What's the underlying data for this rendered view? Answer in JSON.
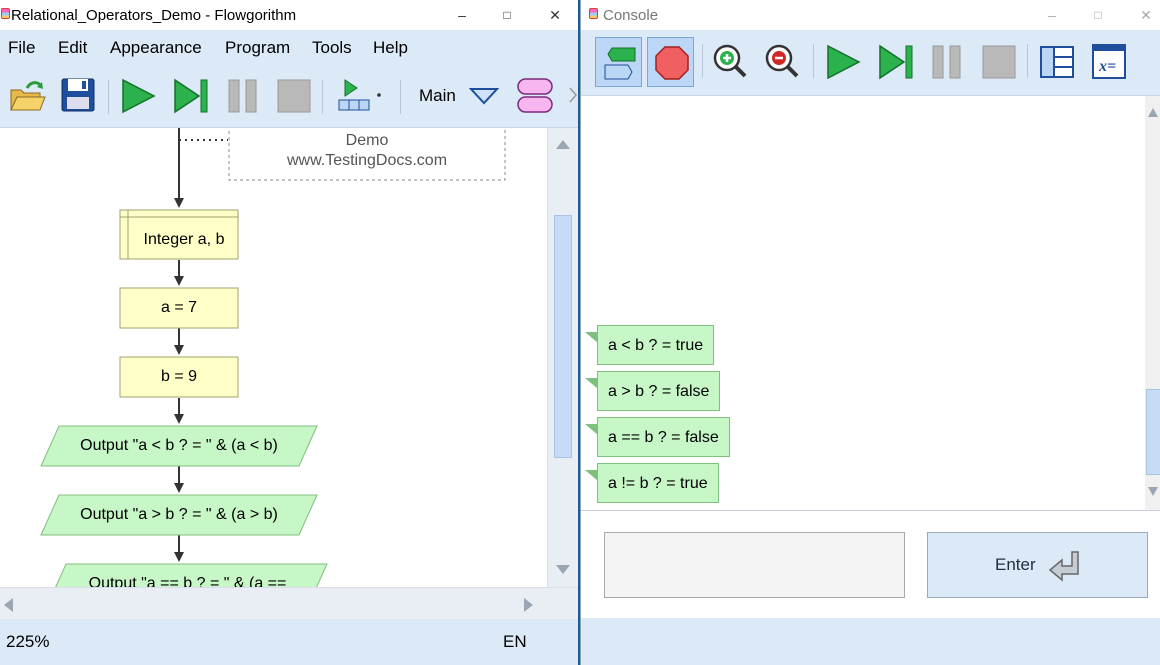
{
  "left_window": {
    "title": "Relational_Operators_Demo - Flowgorithm",
    "controls": {
      "minimize": "–",
      "maximize": "□",
      "close": "✕"
    },
    "menu": [
      "File",
      "Edit",
      "Appearance",
      "Program",
      "Tools",
      "Help"
    ],
    "toolbar": {
      "icons": [
        "open-icon",
        "save-icon",
        "run-icon",
        "step-icon",
        "pause-icon",
        "stop-icon",
        "layout-icon",
        "function-shape-icon"
      ],
      "function_select": "Main"
    },
    "flowchart": {
      "comment_lines": [
        "Demo",
        "www.TestingDocs.com"
      ],
      "declare": "Integer a, b",
      "assign1": "a = 7",
      "assign2": "b = 9",
      "output1": "Output \"a < b ? = \" & (a < b)",
      "output2": "Output \"a > b ? = \" & (a > b)",
      "output3": "Output \"a == b ? = \" & (a =="
    },
    "status": {
      "zoom": "225%",
      "language": "EN"
    }
  },
  "console_window": {
    "title": "Console",
    "controls": {
      "minimize": "–",
      "maximize": "□",
      "close": "✕"
    },
    "toolbar_icons": [
      "chat-layout-icon",
      "stop-sign-icon",
      "zoom-in-icon",
      "zoom-out-icon",
      "run-icon",
      "step-icon",
      "pause-icon",
      "stop-icon",
      "layout-icon",
      "variables-icon"
    ],
    "outputs": [
      "a < b ? = true",
      "a > b ? = false",
      "a == b ? = false",
      "a != b ? = true"
    ],
    "input_value": "",
    "enter_label": "Enter"
  },
  "colors": {
    "accent": "#dce9f7",
    "output_bubble": "#c7f7c7",
    "shape_fill": "#ffffc8",
    "run_green": "#2bb24c"
  }
}
